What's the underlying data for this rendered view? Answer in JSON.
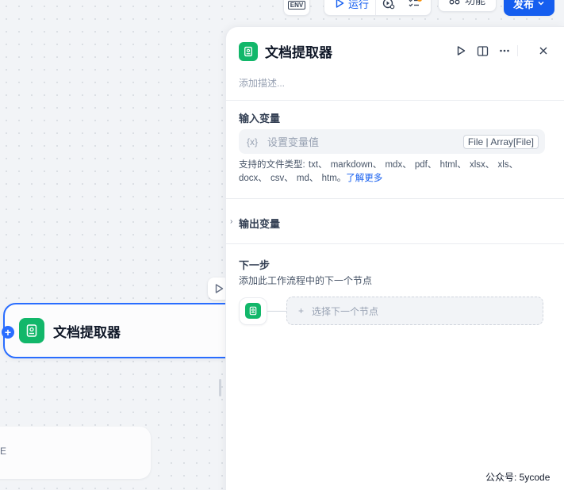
{
  "toolbar": {
    "env_label": "ENV",
    "run_label": "运行",
    "features_label": "功能",
    "publish_label": "发布"
  },
  "canvas": {
    "node_title": "文档提取器",
    "fragment_char": "E"
  },
  "panel": {
    "title": "文档提取器",
    "description_placeholder": "添加描述...",
    "input_section": {
      "title": "输入变量",
      "variable_icon": "{x}",
      "placeholder": "设置变量值",
      "type_tag": "File | Array[File]",
      "supported_prefix": "支持的文件类型: txt、 markdown、 mdx、 pdf、 html、 xlsx、 xls、 docx、 csv、 md、 htm。",
      "learn_more": "了解更多"
    },
    "output_section": {
      "title": "输出变量"
    },
    "next_step": {
      "title": "下一步",
      "description": "添加此工作流程中的下一个节点",
      "select_label": "选择下一个节点"
    }
  },
  "watermark": "公众号: 5ycode",
  "colors": {
    "accent": "#155eef",
    "node_border": "#296dff",
    "node_icon": "#12b76a",
    "badge": "#f79009"
  },
  "icons": [
    "env-icon",
    "play-icon",
    "debug-icon",
    "checklist-icon",
    "features-icon",
    "chevron-down-icon",
    "document-icon",
    "split-view-icon",
    "more-icon",
    "close-icon",
    "plus-icon"
  ]
}
